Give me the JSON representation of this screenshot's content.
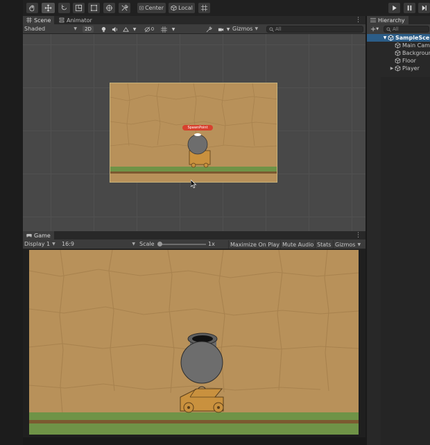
{
  "toolbar": {
    "tools": [
      "hand-tool",
      "move-tool",
      "rotate-tool",
      "scale-tool",
      "rect-tool",
      "transform-tool",
      "custom-tool"
    ],
    "pivot_center": "Center",
    "pivot_local": "Local"
  },
  "scene": {
    "tab_scene": "Scene",
    "tab_animator": "Animator",
    "shading": "Shaded",
    "mode_2d": "2D",
    "hidden_count": "0",
    "gizmos": "Gizmos",
    "search_placeholder": "All",
    "spawn_label": "SpawnPoint"
  },
  "game": {
    "tab": "Game",
    "display": "Display 1",
    "aspect": "16:9",
    "scale_label": "Scale",
    "scale_value": "1x",
    "scale_fraction": 0.0,
    "maximize": "Maximize On Play",
    "mute": "Mute Audio",
    "stats": "Stats",
    "gizmos": "Gizmos"
  },
  "hierarchy": {
    "tab": "Hierarchy",
    "search_placeholder": "All",
    "scene_name": "SampleScene",
    "items": [
      {
        "label": "Main Camera",
        "expandable": false
      },
      {
        "label": "Background",
        "expandable": false
      },
      {
        "label": "Floor",
        "expandable": false
      },
      {
        "label": "Player",
        "expandable": true
      }
    ]
  },
  "colors": {
    "sand": "#b8915a",
    "crack": "#9c7745",
    "grass": "#6f9347",
    "dirt": "#7c5a30",
    "cannon": "#6d6d6d",
    "cart": "#c9913e",
    "selection": "#2c5d87"
  }
}
